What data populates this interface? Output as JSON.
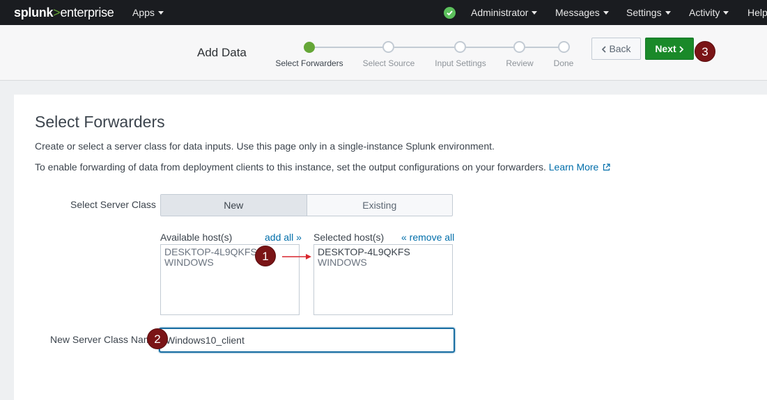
{
  "app": {
    "brand_bold": "splunk",
    "brand_gt": ">",
    "brand_rest": "enterprise"
  },
  "nav": {
    "apps": "Apps",
    "status_icon": "check-circle-icon",
    "administrator": "Administrator",
    "messages": "Messages",
    "settings": "Settings",
    "activity": "Activity",
    "help": "Help"
  },
  "header": {
    "title": "Add Data",
    "steps": [
      {
        "label": "Select Forwarders",
        "state": "current"
      },
      {
        "label": "Select Source",
        "state": "pending"
      },
      {
        "label": "Input Settings",
        "state": "pending"
      },
      {
        "label": "Review",
        "state": "pending"
      },
      {
        "label": "Done",
        "state": "pending"
      }
    ],
    "back_label": "Back",
    "next_label": "Next"
  },
  "main": {
    "title": "Select Forwarders",
    "desc1": "Create or select a server class for data inputs. Use this page only in a single-instance Splunk environment.",
    "desc2": "To enable forwarding of data from deployment clients to this instance, set the output configurations on your forwarders.",
    "learn_more": "Learn More",
    "server_class_label": "Select Server Class",
    "server_class_options": [
      "New",
      "Existing"
    ],
    "server_class_selected": "New",
    "available_label": "Available host(s)",
    "add_all": "add all »",
    "selected_label": "Selected host(s)",
    "remove_all": "« remove all",
    "available_hosts": [
      {
        "name": "DESKTOP-4L9QKFS",
        "type": "WINDOWS"
      }
    ],
    "selected_hosts": [
      {
        "name": "DESKTOP-4L9QKFS",
        "type": "WINDOWS"
      }
    ],
    "new_class_label": "New Server Class Name",
    "new_class_value": "Windows10_client"
  },
  "annotations": [
    "1",
    "2",
    "3"
  ],
  "colors": {
    "topbar": "#1a1c20",
    "accent_green": "#65a637",
    "next_button": "#1a8929",
    "link": "#006eaa",
    "badge": "#7a1416",
    "focus_border": "#1a6fa3"
  }
}
